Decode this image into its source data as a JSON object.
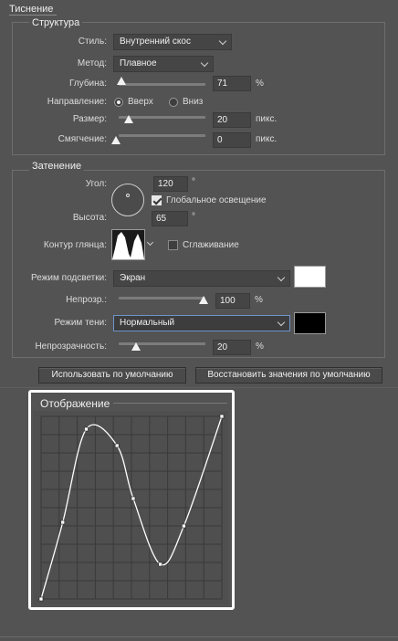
{
  "section_title": "Тиснение",
  "structure": {
    "legend": "Структура",
    "style_label": "Стиль:",
    "style_value": "Внутренний скос",
    "method_label": "Метод:",
    "method_value": "Плавное",
    "depth_label": "Глубина:",
    "depth_value": "71",
    "depth_unit": "%",
    "depth_level": 0.03,
    "direction_label": "Направление:",
    "direction_up": "Вверх",
    "direction_down": "Вниз",
    "direction_selected": "up",
    "size_label": "Размер:",
    "size_value": "20",
    "size_unit": "пикс.",
    "size_level": 0.2,
    "soften_label": "Смягчение:",
    "soften_value": "0",
    "soften_unit": "пикс.",
    "soften_level": 0.0
  },
  "shading": {
    "legend": "Затенение",
    "angle_label": "Угол:",
    "angle_value": "120",
    "angle_unit": "°",
    "global_light_label": "Глобальное освещение",
    "global_light_checked": true,
    "altitude_label": "Высота:",
    "altitude_value": "65",
    "altitude_unit": "°",
    "gloss_contour_label": "Контур глянца:",
    "antialias_label": "Сглаживание",
    "antialias_checked": false,
    "highlight_mode_label": "Режим подсветки:",
    "highlight_mode_value": "Экран",
    "highlight_color": "#ffffff",
    "highlight_opacity_label": "Непрозр.:",
    "highlight_opacity_value": "100",
    "highlight_opacity_unit": "%",
    "highlight_opacity_level": 1.0,
    "shadow_mode_label": "Режим тени:",
    "shadow_mode_value": "Нормальный",
    "shadow_color": "#000000",
    "shadow_opacity_label": "Непрозрачность:",
    "shadow_opacity_value": "20",
    "shadow_opacity_unit": "%",
    "shadow_opacity_level": 0.2
  },
  "buttons": {
    "make_default": "Использовать по умолчанию",
    "reset_default": "Восстановить значения по умолчанию"
  },
  "curve": {
    "legend": "Отображение",
    "points": [
      [
        0,
        0
      ],
      [
        12,
        42
      ],
      [
        25,
        93
      ],
      [
        42,
        84
      ],
      [
        51,
        55
      ],
      [
        66,
        19
      ],
      [
        79,
        40
      ],
      [
        100,
        100
      ]
    ]
  },
  "colors": {
    "panel": "#535353",
    "accent_border": "#6d93c9",
    "graph_bg": "#4f4f4f",
    "graph_line": "#ffffff"
  }
}
